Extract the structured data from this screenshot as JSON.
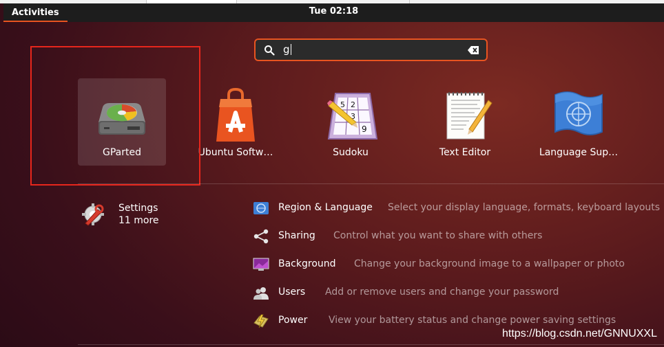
{
  "topbar": {
    "activities_label": "Activities",
    "clock": "Tue 02:18"
  },
  "search": {
    "query": "g"
  },
  "apps": [
    {
      "name": "GParted",
      "icon": "gparted-icon"
    },
    {
      "name": "Ubuntu Softw…",
      "icon": "ubuntu-software-icon"
    },
    {
      "name": "Sudoku",
      "icon": "sudoku-icon"
    },
    {
      "name": "Text Editor",
      "icon": "text-editor-icon"
    },
    {
      "name": "Language Sup…",
      "icon": "language-support-icon"
    }
  ],
  "provider": {
    "name": "Settings",
    "more": "11 more"
  },
  "settings_results": [
    {
      "title": "Region & Language",
      "description": "Select your display language, formats, keyboard layouts …",
      "icon": "globe-icon"
    },
    {
      "title": "Sharing",
      "description": "Control what you want to share with others",
      "icon": "share-icon"
    },
    {
      "title": "Background",
      "description": "Change your background image to a wallpaper or photo",
      "icon": "wallpaper-icon"
    },
    {
      "title": "Users",
      "description": "Add or remove users and change your password",
      "icon": "users-icon"
    },
    {
      "title": "Power",
      "description": "View your battery status and change power saving settings",
      "icon": "power-icon"
    }
  ],
  "watermark": "https://blog.csdn.net/GNNUXXL",
  "colors": {
    "accent": "#e95420",
    "highlight_box": "#e8261c",
    "topbar": "#1d1d1d"
  }
}
